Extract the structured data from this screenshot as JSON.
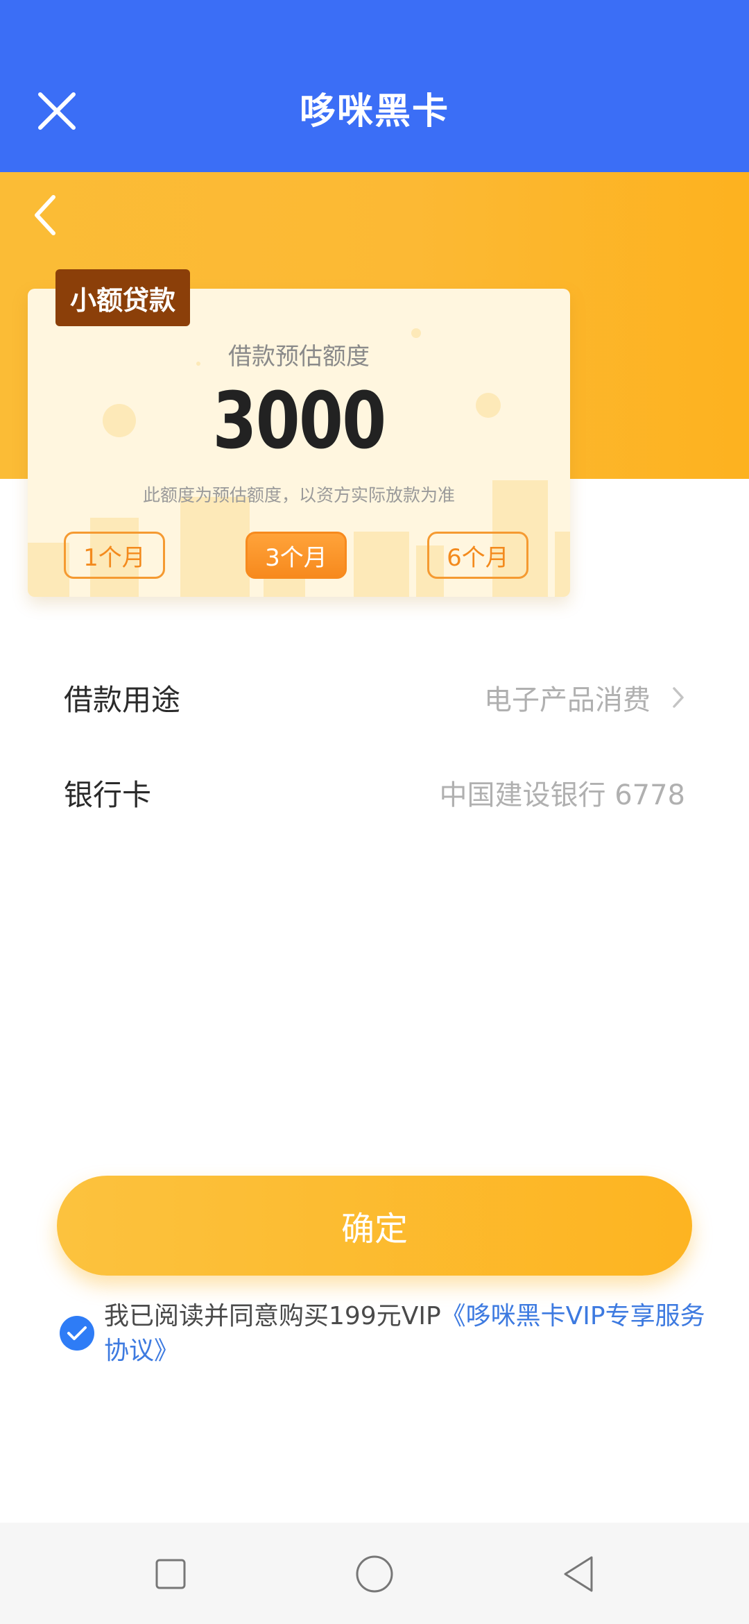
{
  "header": {
    "title": "哆咪黑卡",
    "bg_color": "#3b6ef6"
  },
  "card": {
    "tag": "小额贷款",
    "label": "借款预估额度",
    "amount": "3000",
    "note": "此额度为预估额度，以资方实际放款为准",
    "terms": [
      {
        "label": "1个月",
        "selected": false
      },
      {
        "label": "3个月",
        "selected": true
      },
      {
        "label": "6个月",
        "selected": false
      }
    ]
  },
  "form": {
    "purpose": {
      "label": "借款用途",
      "value": "电子产品消费"
    },
    "bank_card": {
      "label": "银行卡",
      "value": "中国建设银行 6778"
    }
  },
  "confirm_button": "确定",
  "agreement": {
    "checked": true,
    "text": "我已阅读并同意购买199元VIP",
    "link": "《哆咪黑卡VIP专享服务协议》"
  },
  "colors": {
    "primary_blue": "#3b6ef6",
    "accent_yellow": "#fdb421",
    "term_orange": "#f78a1e",
    "tag_brown": "#8b3f09",
    "link_blue": "#3d7ae0"
  },
  "icons": {
    "close": "close-icon",
    "back": "back-arrow-icon",
    "chevron": "chevron-right-icon",
    "check": "checkmark-icon",
    "nav_recent": "square-icon",
    "nav_home": "circle-icon",
    "nav_back": "triangle-back-icon"
  }
}
